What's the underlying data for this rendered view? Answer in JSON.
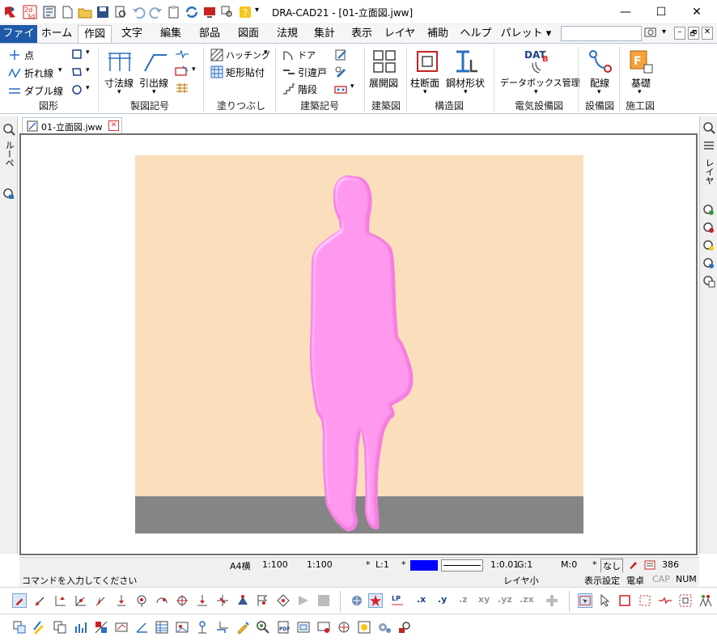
{
  "window": {
    "title": "DRA-CAD21 - [01-立面図.jww]",
    "minimize": "—",
    "maximize": "☐",
    "close": "✕"
  },
  "menu": {
    "tabs": [
      "ファイル",
      "ホーム",
      "作図",
      "文字",
      "編集",
      "部品",
      "図面",
      "法規",
      "集計",
      "表示",
      "レイヤ",
      "補助",
      "ヘルプ",
      "パレット ▾"
    ],
    "active": "作図",
    "mdi_min": "–",
    "mdi_restore": "🗗",
    "mdi_close": "✕"
  },
  "ribbon": {
    "zukei": {
      "point": "点",
      "polyline": "折れ線",
      "double": "ダブル線",
      "label": "図形"
    },
    "seizu": {
      "dim": "寸法線",
      "leader": "引出線",
      "label": "製図記号"
    },
    "nuri": {
      "hatch": "ハッチング",
      "rect": "矩形貼付",
      "label": "塗りつぶし"
    },
    "kenchiku": {
      "door": "ドア",
      "sliding": "引違戸",
      "stairs": "階段",
      "label": "建築記号"
    },
    "kenchikuzu": {
      "tenkai": "展開図",
      "label": "建築図"
    },
    "kouzou": {
      "column": "柱断面",
      "steel": "鋼材形状",
      "label": "構造図"
    },
    "denki": {
      "databox": "データボックス管理",
      "label": "電気設備図"
    },
    "setsubi": {
      "wiring": "配線",
      "label": "設備図"
    },
    "sekou": {
      "kiso": "基礎",
      "label": "施工図"
    }
  },
  "left_panel": {
    "tab": "ルーペ"
  },
  "right_panel": {
    "tab": "レイヤ"
  },
  "document": {
    "tab_name": "01-立面図.jww"
  },
  "colors": {
    "background": "#fbdfbd",
    "floor": "#858585",
    "figure": "#f57ee0"
  },
  "status": {
    "paper": "A4横",
    "scale1": "1:100",
    "scale2": "1:100",
    "layer": "L:1",
    "line_scale": "1:0.01",
    "group": "G:1",
    "mode": "M:0",
    "none": "なし",
    "count": "386",
    "prompt": "コマンドを入力してください",
    "layer_small": "レイヤ小",
    "display_setting": "表示設定",
    "calc": "電卓",
    "cap": "CAP",
    "num": "NUM"
  },
  "snap_labels": {
    "x": ".x",
    "y": ".y",
    "z": ".z",
    "xy": "xy",
    "yz": ".yz",
    "zx": ".zx"
  }
}
